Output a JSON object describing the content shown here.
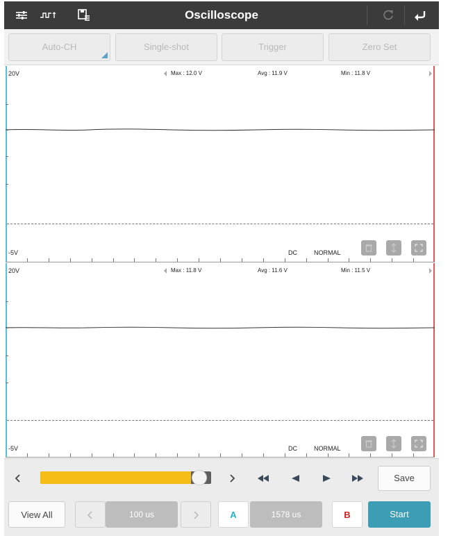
{
  "app": {
    "title": "Oscilloscope",
    "header_icons": [
      "sliders-icon",
      "waveform-icon",
      "save-file-icon",
      "refresh-icon",
      "back-icon"
    ]
  },
  "toolbar": {
    "buttons": [
      {
        "label": "Auto-CH"
      },
      {
        "label": "Single-shot"
      },
      {
        "label": "Trigger"
      },
      {
        "label": "Zero Set"
      }
    ]
  },
  "channels": [
    {
      "top_label": "20V",
      "bottom_label": "-5V",
      "max": "Max : 12.0 V",
      "avg": "Avg : 11.9 V",
      "min": "Min : 11.8 V",
      "coupling": "DC",
      "mode": "NORMAL"
    },
    {
      "top_label": "20V",
      "bottom_label": "-5V",
      "max": "Max : 11.8 V",
      "avg": "Avg : 11.6 V",
      "min": "Min : 11.5 V",
      "coupling": "DC",
      "mode": "NORMAL"
    }
  ],
  "playback": {
    "position_fraction": 0.93,
    "save_label": "Save"
  },
  "bottom": {
    "view_all_label": "View All",
    "timebase": "100 us",
    "cursor_a": "A",
    "cursor_delta": "1578 us",
    "cursor_b": "B",
    "start_label": "Start"
  },
  "colors": {
    "header_bg": "#3b3b3b",
    "accent_teal": "#3c9db5",
    "slider_fill": "#f6bd16",
    "cursor_a": "#4fc3d9",
    "cursor_b": "#e05555"
  }
}
